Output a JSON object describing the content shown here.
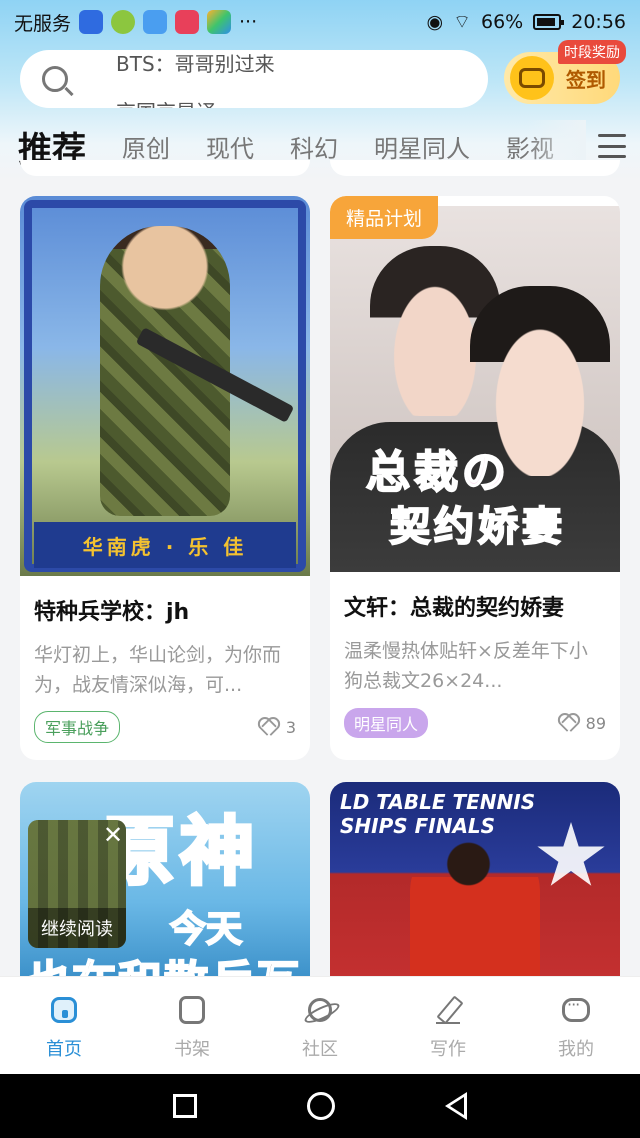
{
  "status_bar": {
    "carrier": "无服务",
    "signal_text": "···",
    "battery": "66%",
    "time": "20:56"
  },
  "search": {
    "line1": "BTS：哥哥别过来",
    "line2": "京国京是译"
  },
  "signin": {
    "label": "签到",
    "badge": "时段奖励"
  },
  "tabs": [
    {
      "label": "推荐",
      "active": true
    },
    {
      "label": "原创"
    },
    {
      "label": "现代"
    },
    {
      "label": "科幻"
    },
    {
      "label": "明星同人"
    },
    {
      "label": "影视"
    }
  ],
  "cards": [
    {
      "title": "特种兵学校：jh",
      "desc": "华灯初上，华山论剑，为你而为，战友情深似海，可...",
      "tag": "军事战争",
      "likes": "3",
      "art_caption": "华南虎 · 乐 佳"
    },
    {
      "badge": "精品计划",
      "title": "文轩：总裁的契约娇妻",
      "desc": "温柔慢热体贴轩×反差年下小狗总裁文26×24...",
      "tag": "明星同人",
      "likes": "89",
      "art_line1": "总裁の",
      "art_line2": "契约娇妻"
    },
    {
      "art_big": "原神",
      "art_mid": "今天",
      "art_bot": "也在和散兵互怼"
    },
    {
      "art_banner": "LD TABLE TENNIS\nSHIPS FINALS"
    }
  ],
  "continue_reading": {
    "label": "继续阅读",
    "close": "✕"
  },
  "bottom_nav": [
    {
      "label": "首页",
      "icon": "home-icon",
      "active": true
    },
    {
      "label": "书架",
      "icon": "bookshelf-icon"
    },
    {
      "label": "社区",
      "icon": "planet-icon"
    },
    {
      "label": "写作",
      "icon": "pen-icon"
    },
    {
      "label": "我的",
      "icon": "chat-icon"
    }
  ],
  "colors": {
    "accent": "#2a8fd6",
    "premium_badge": "#f7a53a",
    "tag_green": "#5bb56e",
    "tag_purple": "#c9a6ec"
  }
}
